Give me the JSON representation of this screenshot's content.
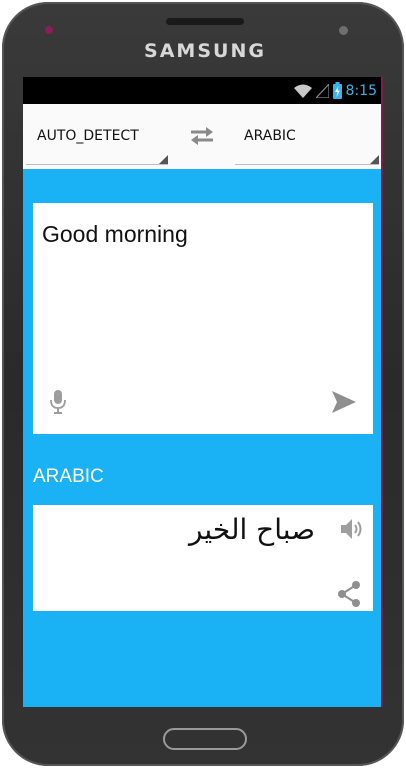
{
  "device": {
    "brand": "SAMSUNG"
  },
  "status_bar": {
    "time": "8:15",
    "icons": [
      "wifi-icon",
      "signal-icon",
      "battery-charging-icon"
    ]
  },
  "toolbar": {
    "source_language": "AUTO_DETECT",
    "target_language": "ARABIC",
    "swap_icon": "swap-arrows-icon"
  },
  "input": {
    "text": "Good morning",
    "mic_icon": "microphone-icon",
    "send_icon": "send-icon"
  },
  "output": {
    "language_label": "ARABIC",
    "text": "صباح الخير",
    "speaker_icon": "speaker-icon",
    "share_icon": "share-icon"
  },
  "colors": {
    "background": "#1ab2f5",
    "toolbar": "#fafafa",
    "card": "#ffffff",
    "icon": "#9e9e9e",
    "clock": "#39b4e8"
  }
}
